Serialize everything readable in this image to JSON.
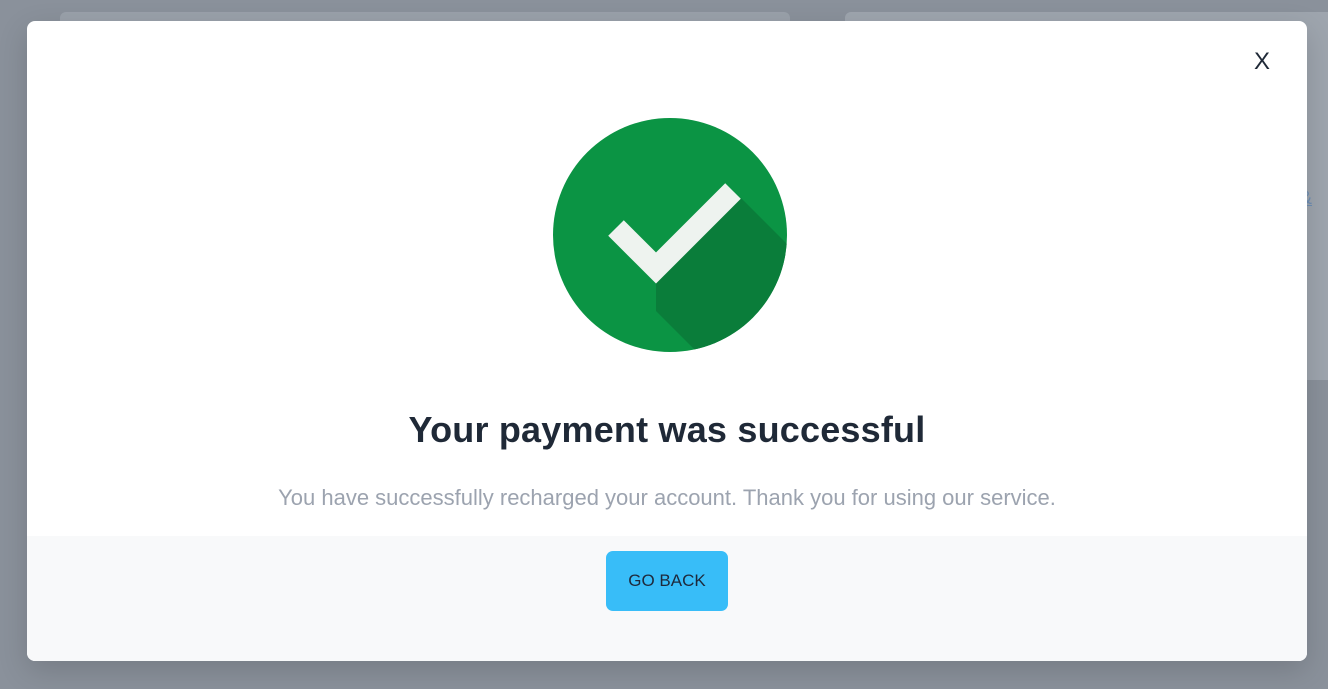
{
  "modal": {
    "close_label": "X",
    "title": "Your payment was successful",
    "message": "You have successfully recharged your account. Thank you for using our service.",
    "button_label": "GO BACK",
    "icon": "check-circle-icon"
  },
  "background": {
    "partial_link_text": "&"
  },
  "colors": {
    "success_green": "#0b9444",
    "success_green_shadow": "#0a7d3a",
    "button_bg": "#38bdf8",
    "title_text": "#1f2937",
    "message_text": "#9ca3af"
  }
}
